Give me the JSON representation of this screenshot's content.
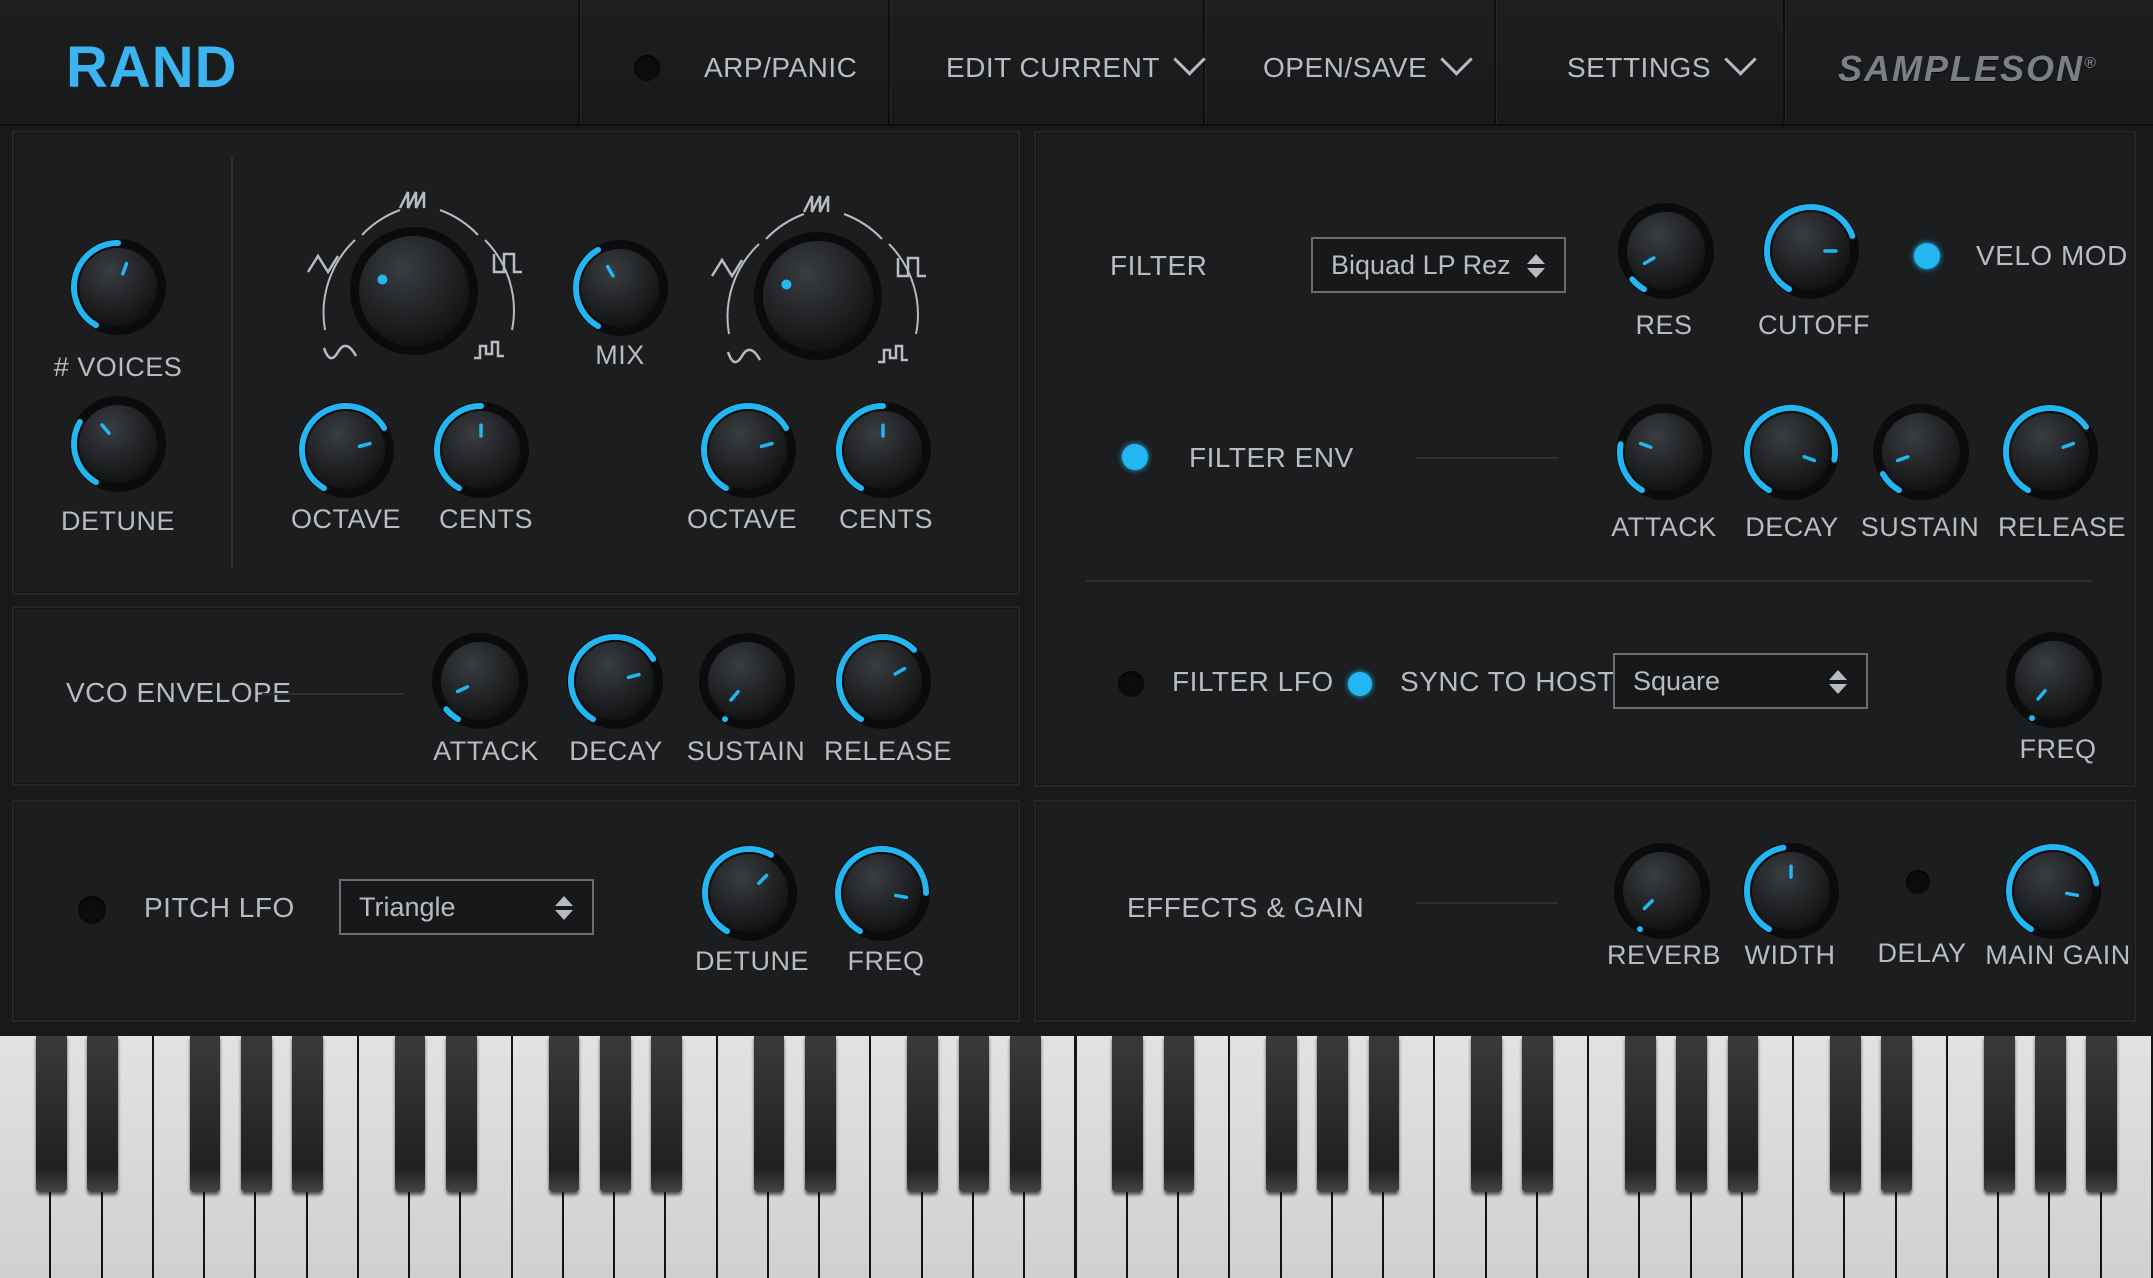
{
  "header": {
    "title": "RAND",
    "menu": [
      {
        "label": "ARP/PANIC"
      },
      {
        "label": "EDIT CURRENT"
      },
      {
        "label": "OPEN/SAVE"
      },
      {
        "label": "SETTINGS"
      }
    ],
    "brand": "SAMPLESON"
  },
  "colors": {
    "accent": "#22b6f2",
    "title": "#3cb4f0",
    "panel": "#1b1d1f",
    "background": "#17191b"
  },
  "oscillators": {
    "voices_label": "# VOICES",
    "detune_label": "DETUNE",
    "mix_label": "MIX",
    "osc1": {
      "octave_label": "OCTAVE",
      "cents_label": "CENTS"
    },
    "osc2": {
      "octave_label": "OCTAVE",
      "cents_label": "CENTS"
    },
    "waveform_icons": [
      "triangle-wave-icon",
      "saw-wave-icon",
      "square-wave-icon",
      "sine-wave-icon",
      "random-wave-icon"
    ]
  },
  "vco_envelope": {
    "title": "VCO ENVELOPE",
    "attack_label": "ATTACK",
    "decay_label": "DECAY",
    "sustain_label": "SUSTAIN",
    "release_label": "RELEASE"
  },
  "pitch_lfo": {
    "title": "PITCH LFO",
    "enabled": false,
    "waveform": "Triangle",
    "detune_label": "DETUNE",
    "freq_label": "FREQ"
  },
  "filter": {
    "title": "FILTER",
    "type": "Biquad LP Rez",
    "res_label": "RES",
    "cutoff_label": "CUTOFF",
    "velo_mod_label": "VELO MOD",
    "velo_mod_enabled": true
  },
  "filter_env": {
    "title": "FILTER ENV",
    "enabled": true,
    "attack_label": "ATTACK",
    "decay_label": "DECAY",
    "sustain_label": "SUSTAIN",
    "release_label": "RELEASE"
  },
  "filter_lfo": {
    "title": "FILTER LFO",
    "enabled": false,
    "sync_label": "SYNC TO HOST",
    "sync_enabled": true,
    "waveform": "Square",
    "freq_label": "FREQ"
  },
  "effects": {
    "title": "EFFECTS & GAIN",
    "reverb_label": "REVERB",
    "width_label": "WIDTH",
    "delay_label": "DELAY",
    "delay_enabled": false,
    "main_gain_label": "MAIN GAIN"
  }
}
